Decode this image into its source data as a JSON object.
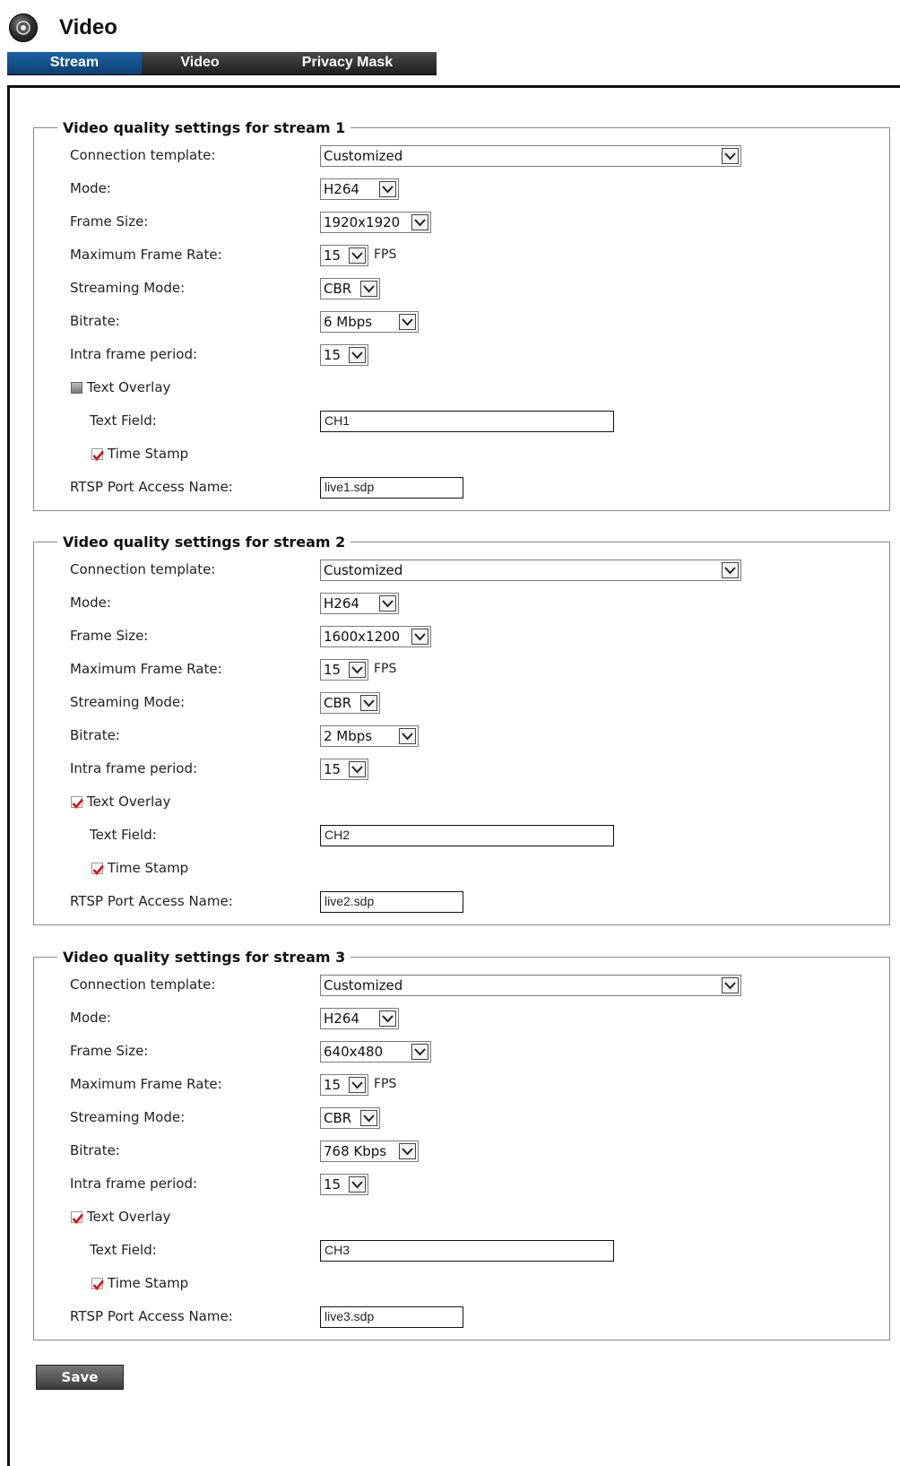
{
  "header": {
    "title": "Video"
  },
  "tabs": [
    {
      "label": "Stream",
      "active": true
    },
    {
      "label": "Video",
      "active": false
    },
    {
      "label": "Privacy Mask",
      "active": false
    }
  ],
  "labels": {
    "connection_template": "Connection template:",
    "mode": "Mode:",
    "frame_size": "Frame Size:",
    "max_frame_rate": "Maximum Frame Rate:",
    "streaming_mode": "Streaming Mode:",
    "bitrate": "Bitrate:",
    "intra_frame_period": "Intra frame period:",
    "text_overlay": "Text Overlay",
    "text_field": "Text Field:",
    "time_stamp": "Time Stamp",
    "rtsp_name": "RTSP Port Access Name:",
    "fps_unit": "FPS"
  },
  "streams": [
    {
      "legend": "Video quality settings for stream  1",
      "connection_template": "Customized",
      "mode": "H264",
      "frame_size": "1920x1920",
      "max_frame_rate": "15",
      "streaming_mode": "CBR",
      "bitrate": "6 Mbps",
      "intra_frame_period": "15",
      "text_overlay": false,
      "text_field": "CH1",
      "time_stamp": true,
      "rtsp_name": "live1.sdp"
    },
    {
      "legend": "Video quality settings for stream  2",
      "connection_template": "Customized",
      "mode": "H264",
      "frame_size": "1600x1200",
      "max_frame_rate": "15",
      "streaming_mode": "CBR",
      "bitrate": "2 Mbps",
      "intra_frame_period": "15",
      "text_overlay": true,
      "text_field": "CH2",
      "time_stamp": true,
      "rtsp_name": "live2.sdp"
    },
    {
      "legend": "Video quality settings for stream  3",
      "connection_template": "Customized",
      "mode": "H264",
      "frame_size": "640x480",
      "max_frame_rate": "15",
      "streaming_mode": "CBR",
      "bitrate": "768 Kbps",
      "intra_frame_period": "15",
      "text_overlay": true,
      "text_field": "CH3",
      "time_stamp": true,
      "rtsp_name": "live3.sdp"
    }
  ],
  "save_label": "Save"
}
